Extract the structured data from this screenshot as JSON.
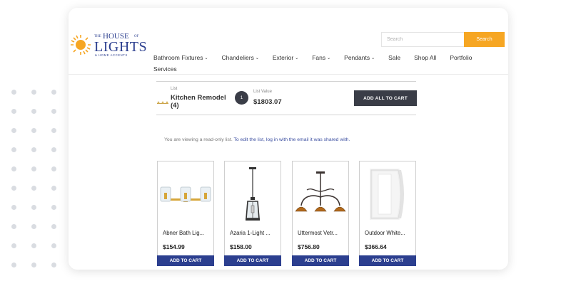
{
  "header": {
    "logo": {
      "line1_small": "THE",
      "line1_big": "HOUSE",
      "line1_small2": "OF",
      "line2": "LIGHTS",
      "line3": "& HOME ACCENTS"
    },
    "search": {
      "placeholder": "Search",
      "button_label": "Search"
    },
    "nav": [
      {
        "label": "Bathroom Fixtures",
        "icon": "chevron-down-icon"
      },
      {
        "label": "Chandeliers",
        "icon": "chevron-down-icon"
      },
      {
        "label": "Exterior",
        "icon": "chevron-down-icon"
      },
      {
        "label": "Fans",
        "icon": "chevron-down-icon"
      },
      {
        "label": "Pendants",
        "icon": "chevron-down-icon"
      },
      {
        "label": "Sale"
      },
      {
        "label": "Shop All"
      },
      {
        "label": "Portfolio"
      },
      {
        "label": "Services"
      }
    ]
  },
  "list": {
    "tag": "List",
    "name": "Kitchen Remodel",
    "count": "(4)",
    "badge": "1",
    "value_tag": "List Value",
    "value": "$1803.07",
    "add_all_label": "ADD ALL TO CART"
  },
  "notice": {
    "text": "You are viewing a read-only list.",
    "link": "To edit the list, log in with the email it was shared with."
  },
  "products": [
    {
      "name": "Abner Bath Lig...",
      "price": "$154.99",
      "button": "ADD TO CART",
      "icon": "vanity-light-image"
    },
    {
      "name": "Azaria 1-Light ...",
      "price": "$158.00",
      "button": "ADD TO CART",
      "icon": "pendant-light-image"
    },
    {
      "name": "Uttermost Vetr...",
      "price": "$756.80",
      "button": "ADD TO CART",
      "icon": "chandelier-image"
    },
    {
      "name": "Outdoor White...",
      "price": "$366.64",
      "button": "ADD TO CART",
      "icon": "wall-sconce-image"
    }
  ],
  "colors": {
    "accent_orange": "#f6a623",
    "brand_blue": "#2c3f8f",
    "dark_button": "#3a3d47"
  }
}
